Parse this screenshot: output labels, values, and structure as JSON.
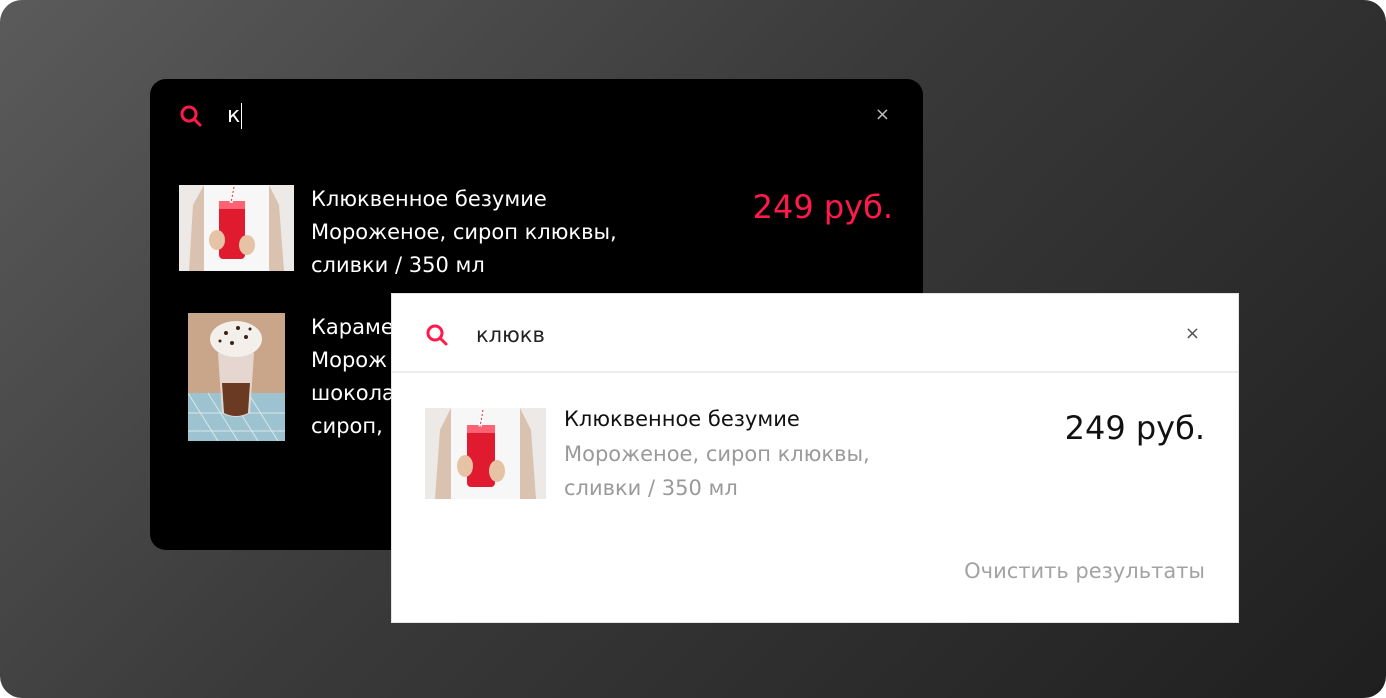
{
  "colors": {
    "accent": "#ff1a4b",
    "dark_panel_bg": "#000000",
    "light_panel_bg": "#ffffff",
    "muted_text": "#9a9a9a"
  },
  "dark_panel": {
    "search_icon": "search-icon",
    "query": "к",
    "close_label": "×",
    "items": [
      {
        "image": "cranberry-drink-photo",
        "lines": [
          "Клюквенное безумие",
          "Мороженое, сироп клюквы,",
          "сливки / 350 мл"
        ],
        "price": "249 руб."
      },
      {
        "image": "caramel-milkshake-photo",
        "lines": [
          "Караме",
          "Морож",
          "шокола",
          "сироп, "
        ]
      }
    ]
  },
  "light_panel": {
    "search_icon": "search-icon",
    "query": "клюкв",
    "close_label": "×",
    "result": {
      "image": "cranberry-drink-photo",
      "title": "Клюквенное безумие",
      "desc_lines": [
        "Мороженое, сироп клюквы,",
        "сливки / 350 мл"
      ],
      "price": "249 руб."
    },
    "clear_label": "Очистить результаты"
  }
}
